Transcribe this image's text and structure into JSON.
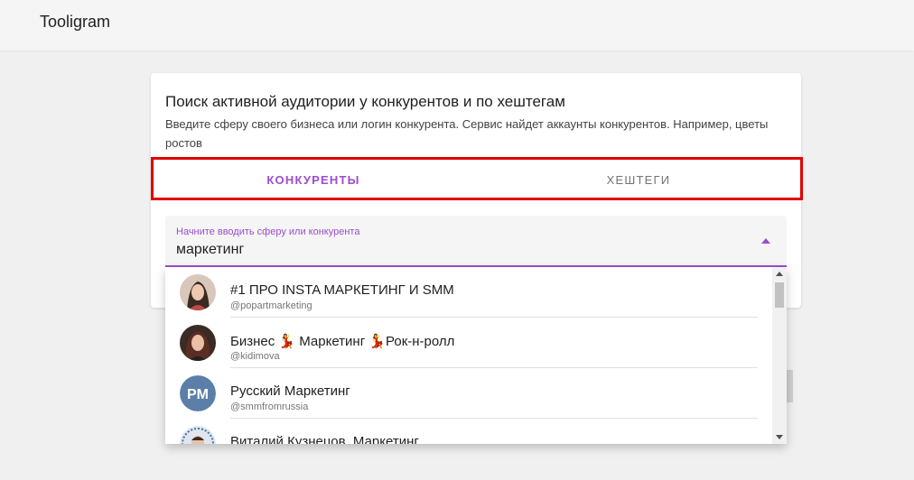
{
  "app": {
    "title": "Tooligram"
  },
  "card": {
    "title": "Поиск активной аудитории у конкурентов и по хештегам",
    "description": "Введите сферу своего бизнеса или логин конкурента. Сервис найдет аккаунты конкурентов. Например, цветы ростов"
  },
  "tabs": [
    {
      "label": "КОНКУРЕНТЫ",
      "active": true
    },
    {
      "label": "ХЕШТЕГИ",
      "active": false
    }
  ],
  "search": {
    "label": "Начните вводить сферу или конкурента",
    "value": "маркетинг"
  },
  "results": [
    {
      "name": "#1 ПРО INSTA МАРКЕТИНГ И SMM",
      "handle": "@popartmarketing",
      "avatar": "woman-photo"
    },
    {
      "name": "Бизнес 💃 Маркетинг 💃Рок-н-ролл",
      "handle": "@kidimova",
      "avatar": "woman-photo"
    },
    {
      "name": "Русский Маркетинг",
      "handle": "@smmfromrussia",
      "avatar": "rm-logo",
      "avatar_text": "PM"
    },
    {
      "name": "Виталий Кузнецов. Маркетинг",
      "handle": "",
      "avatar": "man-photo"
    }
  ],
  "colors": {
    "accent": "#9c4dcc",
    "highlight": "#e00000",
    "rm_logo_bg": "#5b7fa8"
  }
}
